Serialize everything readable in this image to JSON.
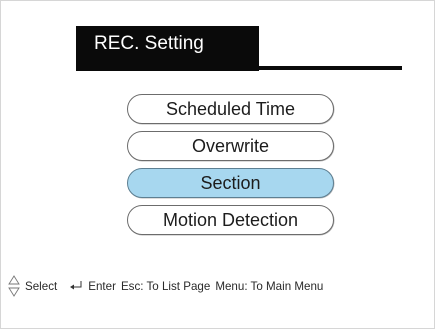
{
  "header": {
    "title": "REC. Setting"
  },
  "menu": {
    "items": [
      {
        "label": "Scheduled Time",
        "selected": false
      },
      {
        "label": "Overwrite",
        "selected": false
      },
      {
        "label": "Section",
        "selected": true
      },
      {
        "label": "Motion Detection",
        "selected": false
      }
    ]
  },
  "footer": {
    "select_icon": "up-down-arrows-icon",
    "select_label": "Select",
    "enter_icon": "enter-return-icon",
    "enter_label": "Enter",
    "esc_label": "Esc: To List Page",
    "menu_label": "Menu: To Main Menu"
  },
  "colors": {
    "selected_background": "#a7d7ef",
    "title_background": "#0a0a0a",
    "title_text": "#ffffff",
    "border": "#6c6c6c"
  }
}
